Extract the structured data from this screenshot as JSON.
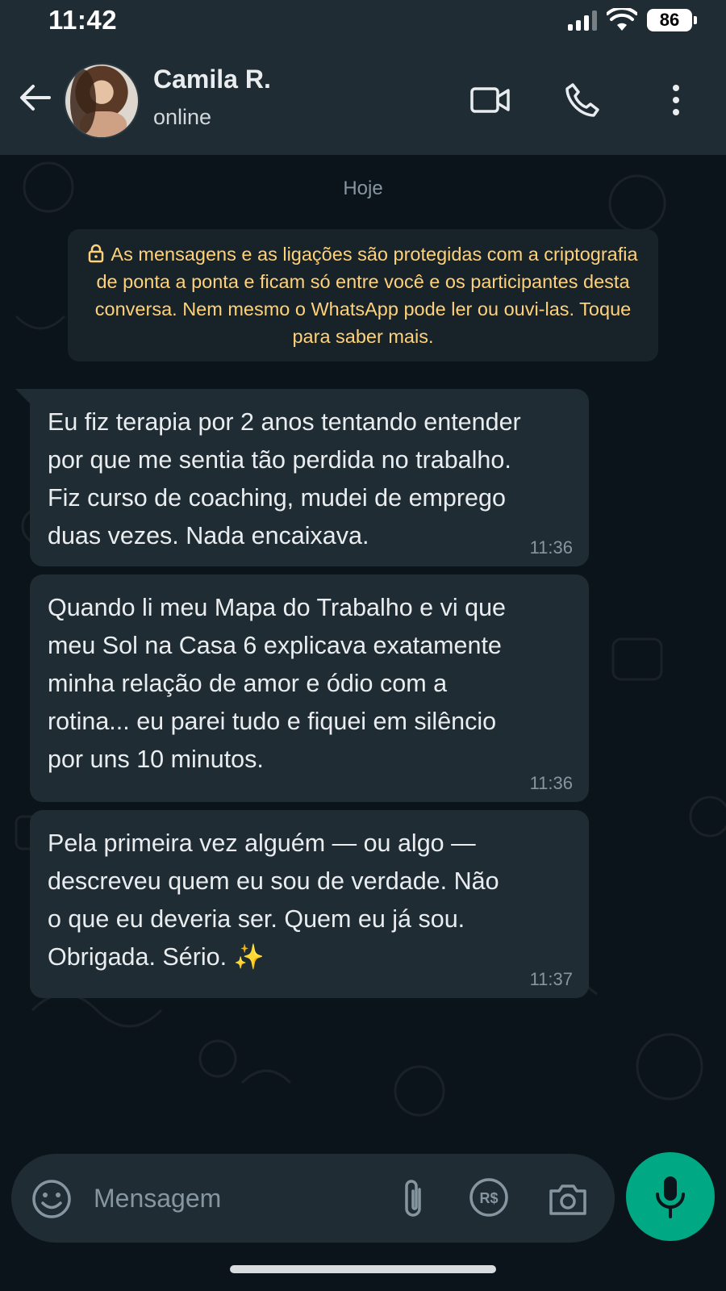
{
  "status_bar": {
    "time": "11:42",
    "battery": "86"
  },
  "header": {
    "contact_name": "Camila R.",
    "contact_status": "online",
    "icons": [
      "back-arrow-icon",
      "video-call-icon",
      "phone-icon",
      "more-vertical-icon"
    ]
  },
  "chat": {
    "day_label": "Hoje",
    "encryption_notice": "As mensagens e as ligações são protegidas com a criptografia de ponta a ponta e ficam só entre você e os participantes desta conversa. Nem mesmo o WhatsApp pode ler ou ouvi-las. Toque para saber mais.",
    "messages": [
      {
        "text": "Eu fiz terapia por 2 anos tentando entender\npor que me sentia tão perdida no trabalho.\nFiz curso de coaching, mudei de emprego\nduas vezes. Nada encaixava.",
        "time": "11:36"
      },
      {
        "text": "Quando li meu Mapa do Trabalho e vi que\nmeu Sol na Casa 6 explicava exatamente\nminha relação de amor e ódio com a\nrotina... eu parei tudo e fiquei em silêncio\npor uns 10 minutos.",
        "time": "11:36"
      },
      {
        "text": "Pela primeira vez alguém — ou algo —\ndescreveu quem eu sou de verdade. Não\no que eu deveria ser. Quem eu já sou.\nObrigada. Sério. ✨",
        "time": "11:37"
      }
    ]
  },
  "composer": {
    "placeholder": "Mensagem",
    "icons": [
      "emoji-icon",
      "paperclip-icon",
      "payment-icon",
      "camera-icon",
      "microphone-icon"
    ]
  },
  "colors": {
    "background": "#0b141a",
    "header": "#1f2c34",
    "bubble": "#202c33",
    "notice_text": "#ffd279",
    "accent": "#00a884"
  }
}
